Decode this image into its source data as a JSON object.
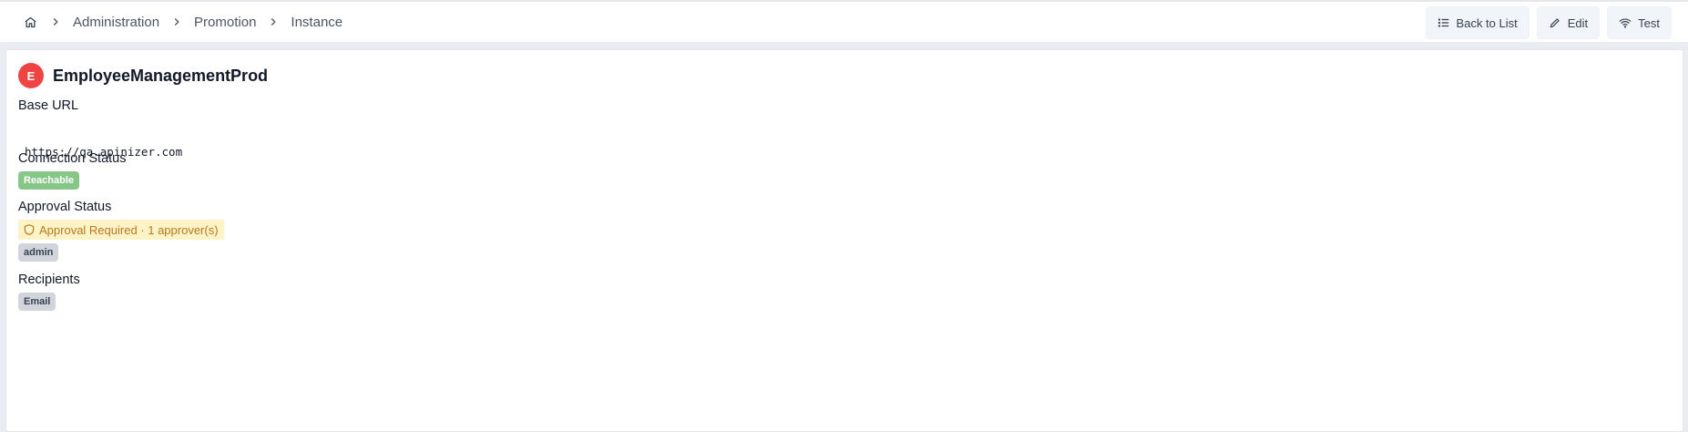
{
  "breadcrumb": {
    "home_icon": "home-icon",
    "items": [
      "Administration",
      "Promotion",
      "Instance"
    ]
  },
  "actions": {
    "back_label": "Back to List",
    "edit_label": "Edit",
    "test_label": "Test"
  },
  "instance": {
    "avatar_letter": "E",
    "name": "EmployeeManagementProd",
    "base_url_label": "Base URL",
    "base_url": "https://qa.apinizer.com",
    "connection_status_label": "Connection Status",
    "connection_status": "Reachable",
    "approval_status_label": "Approval Status",
    "approval_status": "Approval Required · 1 approver(s)",
    "approver": "admin",
    "recipients_label": "Recipients",
    "recipient": "Email"
  },
  "colors": {
    "avatar": "#ef4444",
    "reachable": "#86c788",
    "approval_bg": "#fef3c7",
    "approval_text": "#b7791f"
  }
}
